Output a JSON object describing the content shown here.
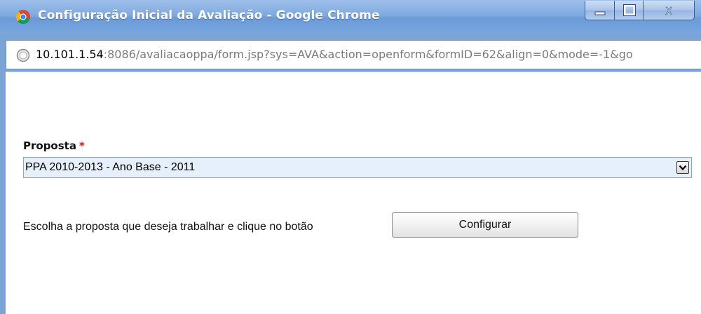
{
  "window": {
    "title": "Configuração Inicial da Avaliação - Google Chrome",
    "app_icon": "chrome-icon",
    "controls": {
      "minimize_icon": "minimize-icon",
      "maximize_icon": "maximize-icon",
      "close_icon": "close-icon"
    }
  },
  "address_bar": {
    "icon": "globe-icon",
    "host": "10.101.1.54",
    "rest": ":8086/avaliacaoppa/form.jsp?sys=AVA&action=openform&formID=62&align=0&mode=-1&go"
  },
  "form": {
    "proposta_label": "Proposta",
    "required_mark": "*",
    "proposta_selected": "PPA 2010-2013 - Ano Base - 2011",
    "hint_text": "Escolha a proposta que deseja trabalhar e clique no botão",
    "configure_button": "Configurar"
  },
  "colors": {
    "titlebar": "#7eaae0",
    "required": "#d62020",
    "select_bg": "#e6f0fa"
  }
}
